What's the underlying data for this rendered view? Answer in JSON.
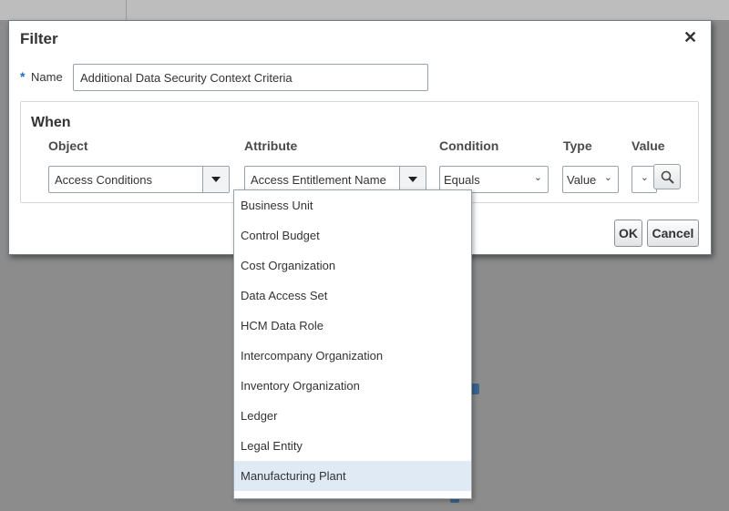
{
  "dialog": {
    "title": "Filter",
    "close_label": "✕"
  },
  "name_field": {
    "required_mark": "*",
    "label": "Name",
    "value": "Additional Data Security Context Criteria"
  },
  "when": {
    "title": "When",
    "columns": {
      "object": "Object",
      "attribute": "Attribute",
      "condition": "Condition",
      "type": "Type",
      "value": "Value"
    },
    "object_value": "Access Conditions",
    "attribute_value": "Access Entitlement Name",
    "condition_value": "Equals",
    "type_value": "Value",
    "value_value": ""
  },
  "buttons": {
    "ok": "OK",
    "cancel": "Cancel"
  },
  "attribute_dropdown": {
    "items": [
      "Business Unit",
      "Control Budget",
      "Cost Organization",
      "Data Access Set",
      "HCM Data Role",
      "Intercompany Organization",
      "Inventory Organization",
      "Ledger",
      "Legal Entity",
      "Manufacturing Plant"
    ],
    "highlighted": "Manufacturing Plant"
  },
  "icons": {
    "close": "close-icon",
    "dropdown": "triangle-down-icon",
    "chevron": "chevron-down-icon",
    "search": "search-icon"
  },
  "colors": {
    "overlay_bg": "#8c8c8c",
    "required_mark": "#1f6fc1",
    "highlight": "#dfeaf5"
  }
}
